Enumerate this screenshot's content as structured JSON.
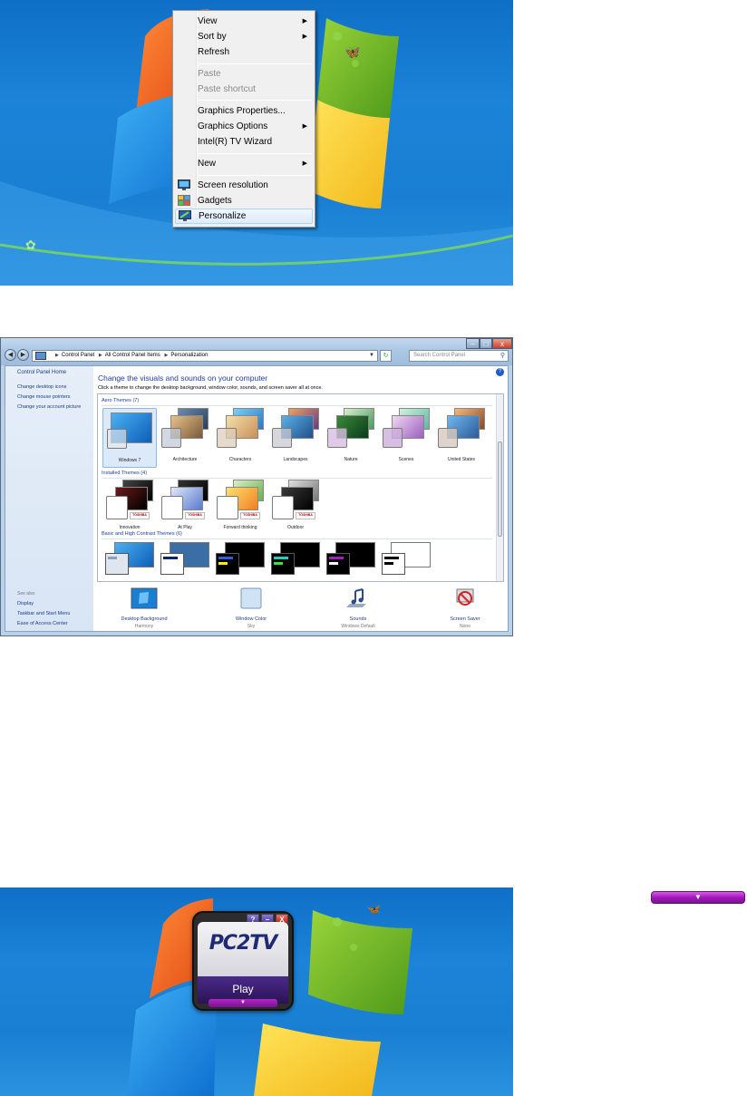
{
  "context_menu": {
    "items": [
      {
        "label": "View",
        "submenu": true,
        "enabled": true
      },
      {
        "label": "Sort by",
        "submenu": true,
        "enabled": true
      },
      {
        "label": "Refresh",
        "submenu": false,
        "enabled": true
      },
      {
        "label": "Paste",
        "submenu": false,
        "enabled": false
      },
      {
        "label": "Paste shortcut",
        "submenu": false,
        "enabled": false
      },
      {
        "label": "Graphics Properties...",
        "submenu": false,
        "enabled": true
      },
      {
        "label": "Graphics Options",
        "submenu": true,
        "enabled": true
      },
      {
        "label": "Intel(R) TV Wizard",
        "submenu": false,
        "enabled": true
      },
      {
        "label": "New",
        "submenu": true,
        "enabled": true
      },
      {
        "label": "Screen resolution",
        "icon": "monitor-icon",
        "enabled": true
      },
      {
        "label": "Gadgets",
        "icon": "gadgets-icon",
        "enabled": true
      },
      {
        "label": "Personalize",
        "icon": "personalize-icon",
        "enabled": true,
        "highlighted": true
      }
    ],
    "submenu_arrow": "▶"
  },
  "window": {
    "address": [
      "Control Panel",
      "All Control Panel Items",
      "Personalization"
    ],
    "search_placeholder": "Search Control Panel",
    "buttons": {
      "minimize": "–",
      "maximize": "□",
      "close": "x"
    },
    "left_pane": {
      "home": "Control Panel Home",
      "links": [
        "Change desktop icons",
        "Change mouse pointers",
        "Change your account picture"
      ],
      "see_also_label": "See also",
      "see_also": [
        "Display",
        "Taskbar and Start Menu",
        "Ease of Access Center"
      ]
    },
    "heading": "Change the visuals and sounds on your computer",
    "subheading": "Click a theme to change the desktop background, window color, sounds, and screen saver all at once.",
    "aero_group": "Aero Themes (7)",
    "aero_themes": [
      "Windows 7",
      "Architecture",
      "Characters",
      "Landscapes",
      "Nature",
      "Scenes",
      "United States"
    ],
    "installed_group": "Installed Themes (4)",
    "installed_themes": [
      "Innovation",
      "At Play",
      "Forward thinking",
      "Outdoor"
    ],
    "installed_badge": "TOSHIBA",
    "basic_group": "Basic and High Contrast Themes (6)",
    "bottom": [
      {
        "label": "Desktop Background",
        "value": "Harmony",
        "icon": "desktop-background-icon"
      },
      {
        "label": "Window Color",
        "value": "Sky",
        "icon": "window-color-icon"
      },
      {
        "label": "Sounds",
        "value": "Windows Default",
        "icon": "sounds-icon"
      },
      {
        "label": "Screen Saver",
        "value": "None",
        "icon": "screen-saver-icon"
      }
    ]
  },
  "pc2tv": {
    "logo": "PC2TV",
    "play": "Play",
    "help": "?",
    "minimize": "–",
    "close": "X",
    "expand_arrow": "▼"
  },
  "expand_bar": {
    "arrow": "▼"
  },
  "colors": {
    "desktop_blue": "#1a7fd2",
    "menu_bg": "#f0f0f0",
    "pc2tv_purple": "#a418bb",
    "link_blue": "#1e3b8a"
  }
}
